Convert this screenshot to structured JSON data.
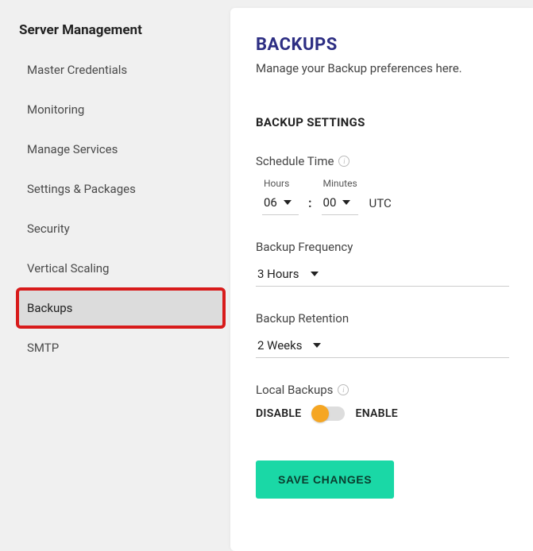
{
  "sidebar": {
    "title": "Server Management",
    "items": [
      {
        "label": "Master Credentials"
      },
      {
        "label": "Monitoring"
      },
      {
        "label": "Manage Services"
      },
      {
        "label": "Settings & Packages"
      },
      {
        "label": "Security"
      },
      {
        "label": "Vertical Scaling"
      },
      {
        "label": "Backups"
      },
      {
        "label": "SMTP"
      }
    ],
    "active_index": 6
  },
  "main": {
    "title": "BACKUPS",
    "subtitle": "Manage your Backup preferences here.",
    "section_title": "BACKUP SETTINGS",
    "schedule": {
      "label": "Schedule Time",
      "hours_label": "Hours",
      "hours_value": "06",
      "minutes_label": "Minutes",
      "minutes_value": "00",
      "tz": "UTC"
    },
    "frequency": {
      "label": "Backup Frequency",
      "value": "3 Hours"
    },
    "retention": {
      "label": "Backup Retention",
      "value": "2 Weeks"
    },
    "local": {
      "label": "Local Backups",
      "disable_label": "DISABLE",
      "enable_label": "ENABLE",
      "state": "disable"
    },
    "save_label": "SAVE CHANGES"
  }
}
